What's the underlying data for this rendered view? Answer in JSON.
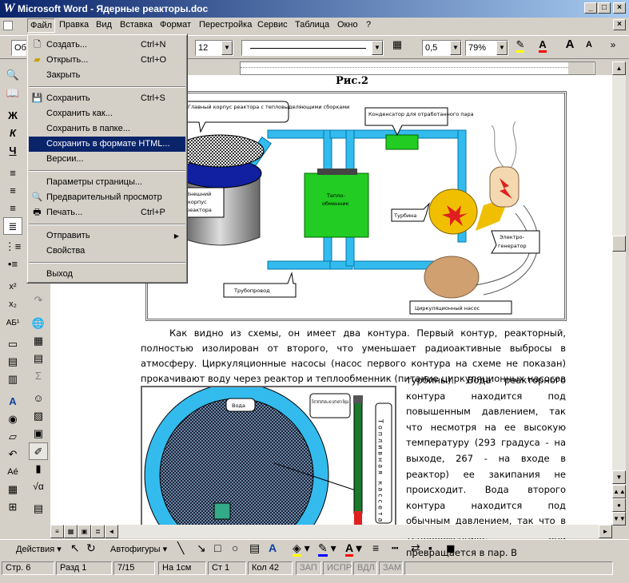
{
  "window": {
    "title": "Microsoft Word - Ядерные реакторы.doc",
    "app_icon": "W"
  },
  "menubar": [
    "Файл",
    "Правка",
    "Вид",
    "Вставка",
    "Формат",
    "Перестройка",
    "Сервис",
    "Таблица",
    "Окно",
    "?"
  ],
  "toolbar": {
    "style_value": "Об",
    "font_size": "12",
    "line_width": "0,5",
    "zoom": "79%"
  },
  "file_menu": [
    {
      "label": "Создать...",
      "shortcut": "Ctrl+N",
      "icon": "new-document-icon"
    },
    {
      "label": "Открыть...",
      "shortcut": "Ctrl+O",
      "icon": "open-folder-icon"
    },
    {
      "label": "Закрыть",
      "shortcut": "",
      "icon": ""
    },
    {
      "label": "Сохранить",
      "shortcut": "Ctrl+S",
      "icon": "save-icon"
    },
    {
      "label": "Сохранить как...",
      "shortcut": "",
      "icon": ""
    },
    {
      "label": "Сохранить в папке...",
      "shortcut": "",
      "icon": ""
    },
    {
      "label": "Сохранить в формате HTML...",
      "shortcut": "",
      "icon": "",
      "selected": true
    },
    {
      "label": "Версии...",
      "shortcut": "",
      "icon": ""
    },
    {
      "label": "Параметры страницы...",
      "shortcut": "",
      "icon": ""
    },
    {
      "label": "Предварительный просмотр",
      "shortcut": "",
      "icon": "print-preview-icon"
    },
    {
      "label": "Печать...",
      "shortcut": "Ctrl+P",
      "icon": "printer-icon"
    },
    {
      "label": "Отправить",
      "shortcut": "",
      "icon": "",
      "submenu": true
    },
    {
      "label": "Свойства",
      "shortcut": "",
      "icon": ""
    },
    {
      "label": "Выход",
      "shortcut": "",
      "icon": ""
    }
  ],
  "document": {
    "figure1_caption": "Рис.2",
    "fig1_labels": {
      "reactor": "Главный корпус реактора с тепловыделяющими сборками",
      "condenser": "Конденсатор для отработанного пара",
      "exchanger_a": "Тепло-",
      "exchanger_b": "обменник",
      "housing_a": "Внешний",
      "housing_b": "корпус",
      "housing_c": "реактора",
      "turbine": "Турбина",
      "generator_a": "Электро-",
      "generator_b": "генератор",
      "pipeline": "Трубопровод",
      "pump": "Циркуляционный насос"
    },
    "paragraph1": "Как видно из схемы, он имеет два контура. Первый контур, реакторный, полностью изолирован от второго, что уменьшает радиоактивные выбросы в атмосферу. Циркуляционные насосы (насос первого контура на схеме не показан) прокачивают воду через реактор и теплообменник (питание циркуляционных насосов происходит от",
    "paragraph2": "турбины). Вода реакторного контура находится под повышенным давлением, так что несмотря на ее высокую температуру (293 градуса - на выходе, 267 - на входе в реактор) ее закипания не происходит. Вода второго контура находится под обычным давлением, так что в теплообменнике она превращается в пар. В",
    "fig2_labels": {
      "water": "Вода",
      "absorber": "Поглотитель из ситного бора",
      "rods": "Топливная кассета"
    }
  },
  "drawing_toolbar": {
    "actions": "Действия",
    "autoshapes": "Автофигуры"
  },
  "status": {
    "page": "Стр. 6",
    "section": "Разд 1",
    "pages": "7/15",
    "at": "На 1см",
    "line": "Ст 1",
    "col": "Кол 42",
    "rec": "ЗАП",
    "trk": "ИСПР",
    "ext": "ВДЛ",
    "ovr": "ЗАМ"
  }
}
